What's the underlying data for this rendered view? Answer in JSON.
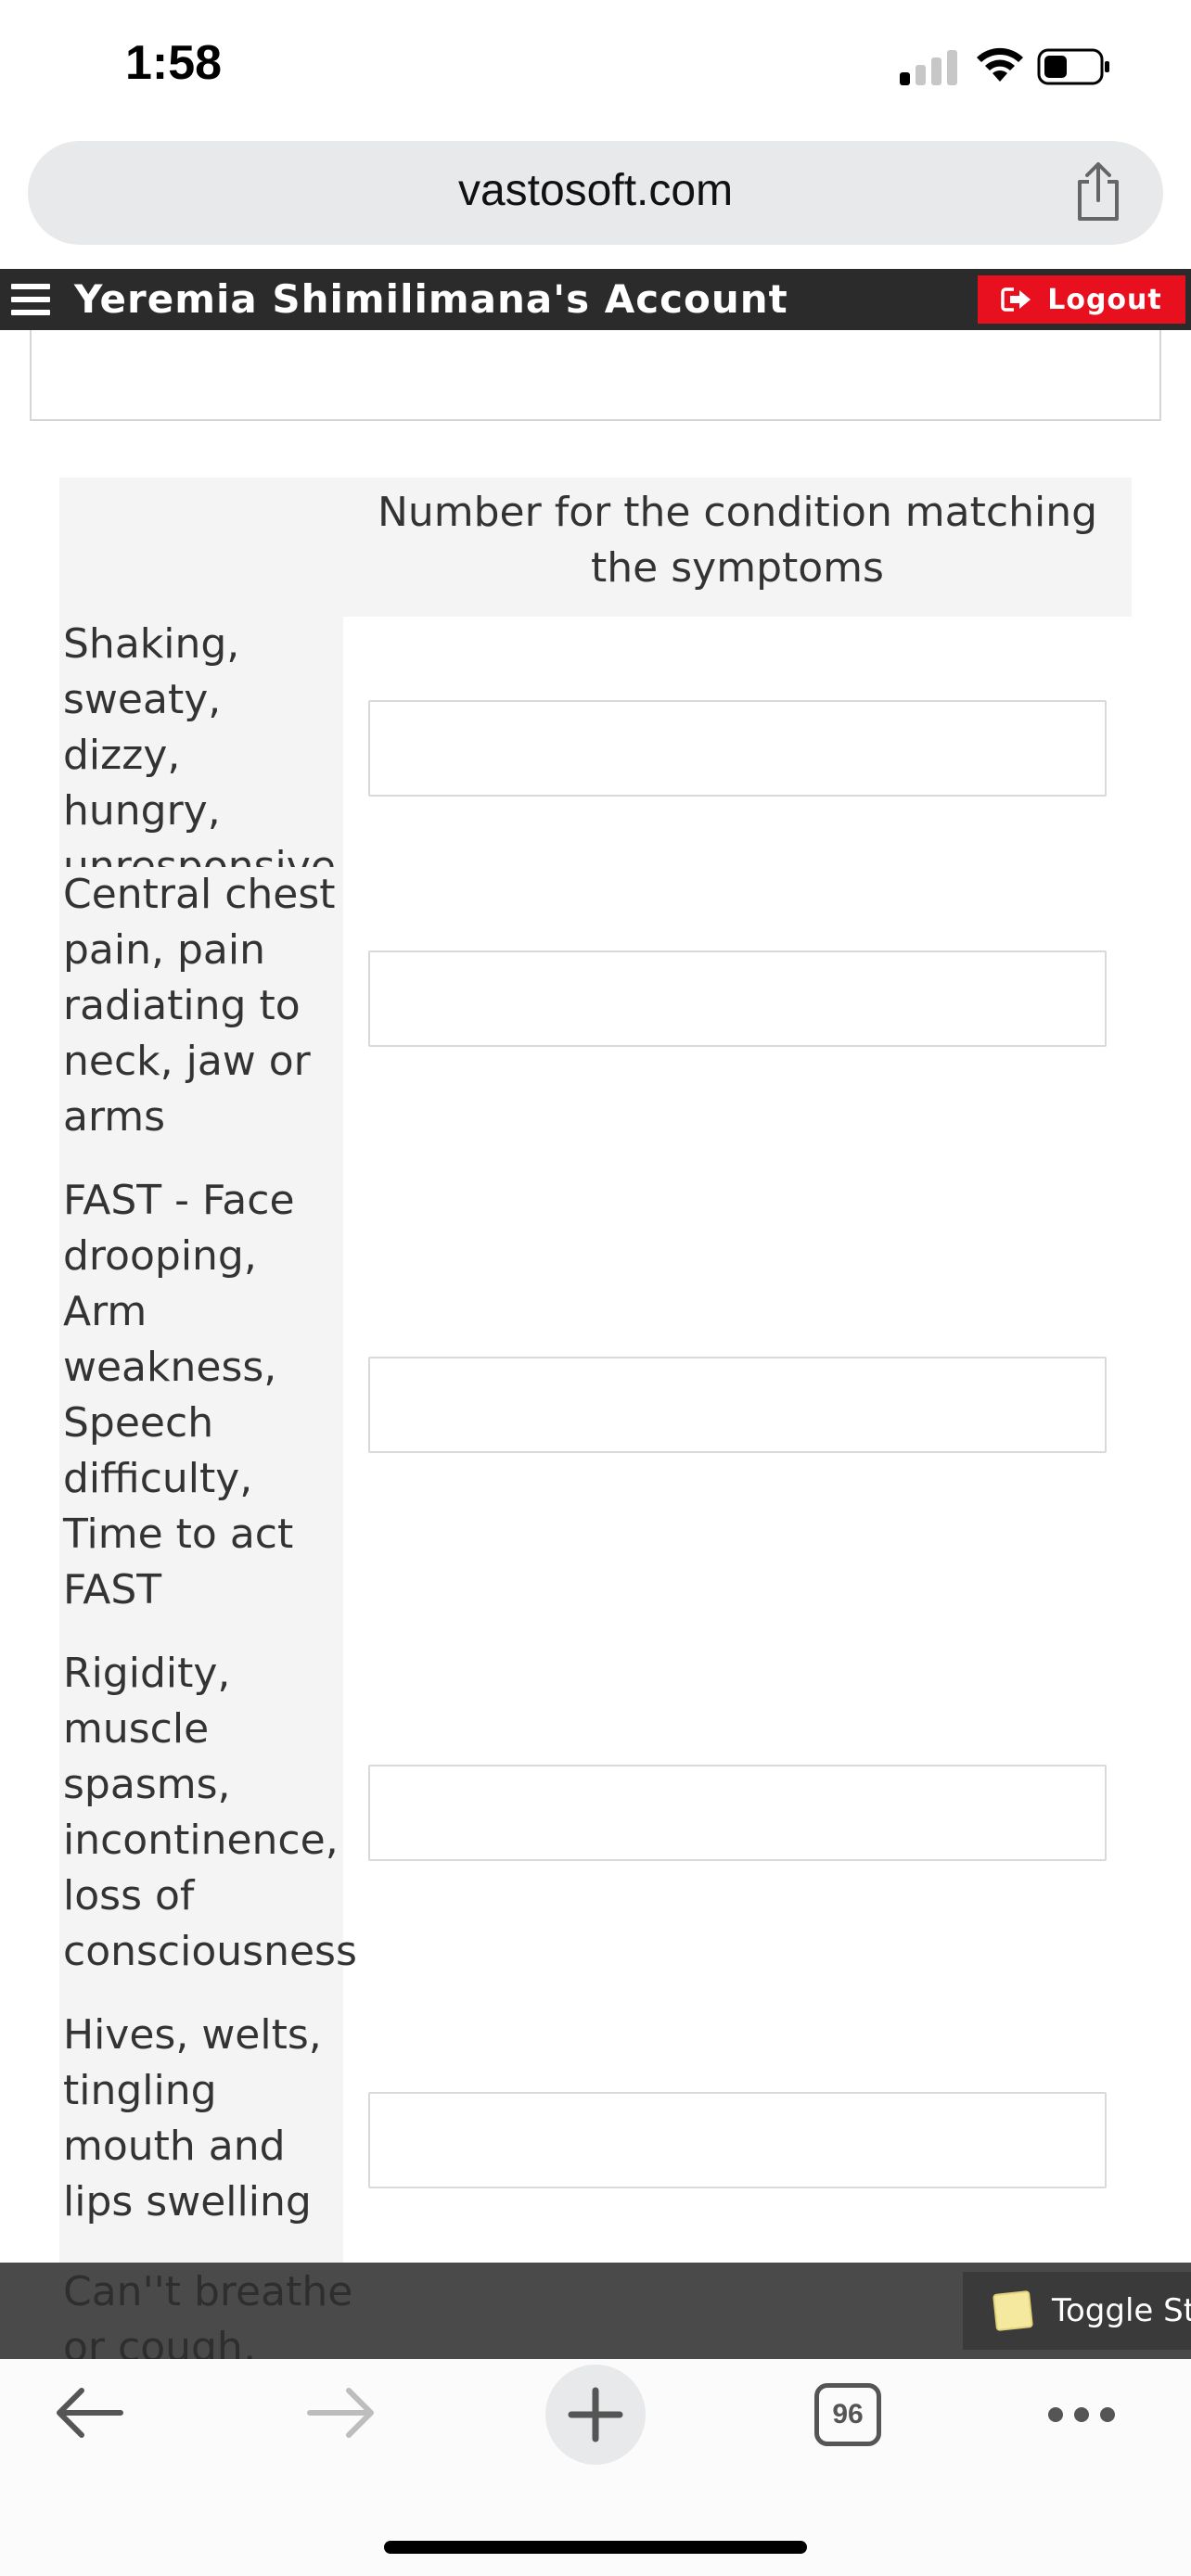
{
  "status_bar": {
    "time": "1:58"
  },
  "browser": {
    "url": "vastosoft.com",
    "tab_count": "96"
  },
  "header": {
    "account_title": "Yeremia Shimilimana's Account",
    "logout_label": "Logout",
    "logout_color": "#e8101f"
  },
  "table": {
    "column_header": "Number for the condition matching the symptoms",
    "rows": [
      {
        "symptoms": "Shaking, sweaty, dizzy, hungry, unresponsive",
        "value": ""
      },
      {
        "symptoms": "Central chest pain, pain radiating to neck, jaw or arms",
        "value": ""
      },
      {
        "symptoms": "FAST - Face drooping, Arm weakness, Speech difficulty, Time to act FAST",
        "value": ""
      },
      {
        "symptoms": "Rigidity, muscle spasms, incontinence, loss of consciousness",
        "value": ""
      },
      {
        "symptoms": "Hives, welts, tingling mouth and lips swelling",
        "value": ""
      },
      {
        "symptoms": "Can''t breathe or cough,",
        "value": ""
      }
    ]
  },
  "sticky_bar": {
    "toggle_label": "Toggle Stic"
  }
}
